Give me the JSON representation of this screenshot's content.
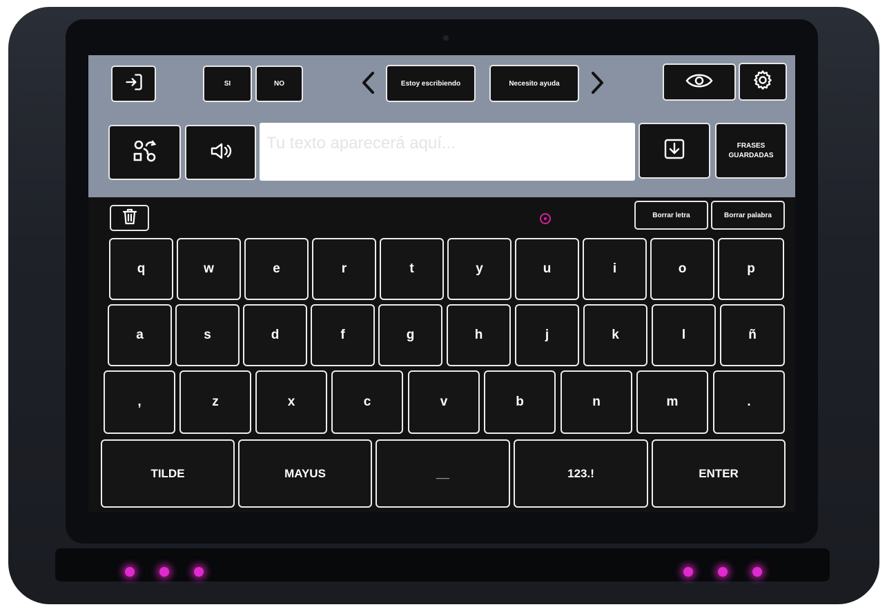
{
  "top_bar": {
    "quick_yes": "SI",
    "quick_no": "NO",
    "phrase_1": "Estoy escribiendo",
    "phrase_2": "Necesito ayuda",
    "prev_symbol": "<",
    "next_symbol": ">"
  },
  "message_bar": {
    "placeholder": "Tu texto aparecerá aquí...",
    "saved_phrases_line1": "FRASES",
    "saved_phrases_line2": "GUARDADAS"
  },
  "edit_bar": {
    "delete_letter": "Borrar letra",
    "delete_word": "Borrar palabra"
  },
  "keyboard": {
    "row1": [
      "q",
      "w",
      "e",
      "r",
      "t",
      "y",
      "u",
      "i",
      "o",
      "p"
    ],
    "row2": [
      "a",
      "s",
      "d",
      "f",
      "g",
      "h",
      "j",
      "k",
      "l",
      "ñ"
    ],
    "row3": [
      ",",
      "z",
      "x",
      "c",
      "v",
      "b",
      "n",
      "m",
      "."
    ],
    "row4": [
      "TILDE",
      "MAYUS",
      "__",
      "123.!",
      "ENTER"
    ]
  },
  "icons": {
    "exit": "exit-icon",
    "eye": "eye-icon",
    "settings": "gear-icon",
    "swap": "swap-icon",
    "speaker": "speaker-icon",
    "save": "save-icon",
    "trash": "trash-icon",
    "gaze_cursor": "gaze-cursor-icon"
  },
  "colors": {
    "top_band": "#8892a2",
    "key_background": "#151515",
    "key_border": "#ededed",
    "led": "#e02ad0"
  }
}
